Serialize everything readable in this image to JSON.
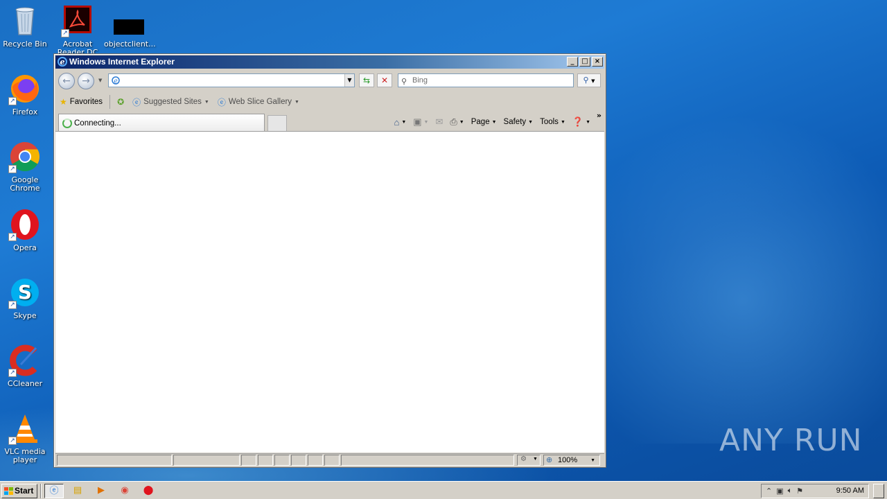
{
  "desktop": {
    "icons": [
      {
        "label": "Recycle Bin",
        "icon": "recycle-bin-icon"
      },
      {
        "label": "Acrobat Reader DC",
        "icon": "acrobat-icon"
      },
      {
        "label": "objectclient...",
        "icon": "file-icon"
      },
      {
        "label": "Firefox",
        "icon": "firefox-icon"
      },
      {
        "label": "Google Chrome",
        "icon": "chrome-icon"
      },
      {
        "label": "Opera",
        "icon": "opera-icon"
      },
      {
        "label": "Skype",
        "icon": "skype-icon"
      },
      {
        "label": "CCleaner",
        "icon": "ccleaner-icon"
      },
      {
        "label": "VLC media player",
        "icon": "vlc-icon"
      }
    ],
    "watermark": "ANY RUN"
  },
  "window": {
    "title": "Windows Internet Explorer",
    "address_value": "",
    "search_placeholder": "Bing",
    "favorites_bar": {
      "favorites_label": "Favorites",
      "suggested_sites": "Suggested Sites",
      "web_slice_gallery": "Web Slice Gallery"
    },
    "tab": {
      "label": "Connecting..."
    },
    "command_bar": {
      "page": "Page",
      "safety": "Safety",
      "tools": "Tools"
    },
    "status": {
      "zoom": "100%"
    }
  },
  "taskbar": {
    "start_label": "Start",
    "clock": "9:50 AM"
  },
  "colors": {
    "desktop_bg": "#1a6fc4",
    "titlebar_start": "#0a246a",
    "titlebar_end": "#a6caf0",
    "chrome": "#d4d0c8"
  }
}
